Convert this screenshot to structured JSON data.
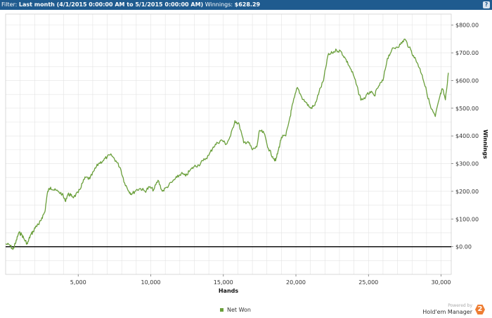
{
  "filter": {
    "label": "Filter:",
    "value": "Last month (4/1/2015 0:00:00 AM to 5/1/2015 0:00:00 AM)",
    "winnings_label": "Winnings:",
    "winnings_value": "$628.29",
    "help": "?"
  },
  "legend": {
    "label": "Net Won"
  },
  "branding": {
    "powered_by": "Powered by",
    "product": "Hold'em Manager",
    "logo_number": "2"
  },
  "colors": {
    "header": "#1f5b8f",
    "series": "#6a9f3b",
    "zero_line": "#000000",
    "grid": "#e3e3e3"
  },
  "chart_data": {
    "type": "line",
    "xlabel": "Hands",
    "ylabel": "Winnings",
    "xlim": [
      0,
      30700
    ],
    "ylim": [
      -100,
      840
    ],
    "x_ticks": [
      5000,
      10000,
      15000,
      20000,
      25000,
      30000
    ],
    "x_tick_labels": [
      "5,000",
      "10,000",
      "15,000",
      "20,000",
      "25,000",
      "30,000"
    ],
    "y_ticks": [
      0,
      100,
      200,
      300,
      400,
      500,
      600,
      700,
      800
    ],
    "y_tick_labels": [
      "$0.00",
      "$100.00",
      "$200.00",
      "$300.00",
      "$400.00",
      "$500.00",
      "$600.00",
      "$700.00",
      "$800.00"
    ],
    "y_axis_side": "right",
    "grid": true,
    "legend_position": "bottom-center",
    "series": [
      {
        "name": "Net Won",
        "x": [
          0,
          300,
          500,
          700,
          900,
          1100,
          1300,
          1500,
          1700,
          1900,
          2100,
          2300,
          2500,
          2700,
          2900,
          3100,
          3300,
          3600,
          3900,
          4100,
          4300,
          4500,
          4700,
          5000,
          5300,
          5500,
          5800,
          6100,
          6400,
          6700,
          7000,
          7300,
          7600,
          7900,
          8200,
          8500,
          8700,
          9000,
          9300,
          9600,
          9900,
          10200,
          10500,
          10800,
          11100,
          11500,
          11800,
          12100,
          12400,
          12700,
          13000,
          13300,
          13600,
          14000,
          14300,
          14600,
          14900,
          15200,
          15500,
          15800,
          16100,
          16400,
          16700,
          17000,
          17300,
          17500,
          17800,
          18100,
          18400,
          18600,
          18800,
          19000,
          19300,
          19600,
          19800,
          20100,
          20400,
          20700,
          21000,
          21300,
          21600,
          21900,
          22200,
          22500,
          22800,
          23100,
          23400,
          23700,
          24000,
          24300,
          24500,
          24800,
          25100,
          25400,
          25700,
          26000,
          26300,
          26600,
          26900,
          27200,
          27500,
          27800,
          28100,
          28400,
          28700,
          29000,
          29300,
          29600,
          29900,
          30100,
          30300,
          30500
        ],
        "values": [
          10,
          5,
          -10,
          15,
          50,
          45,
          25,
          10,
          40,
          55,
          75,
          80,
          105,
          125,
          200,
          215,
          205,
          200,
          190,
          165,
          190,
          185,
          180,
          195,
          230,
          250,
          245,
          275,
          300,
          310,
          325,
          330,
          310,
          285,
          230,
          200,
          190,
          205,
          210,
          200,
          215,
          205,
          240,
          200,
          215,
          235,
          250,
          265,
          255,
          275,
          290,
          295,
          310,
          330,
          360,
          375,
          385,
          370,
          400,
          455,
          440,
          375,
          380,
          350,
          360,
          420,
          410,
          355,
          325,
          310,
          350,
          395,
          400,
          470,
          520,
          575,
          540,
          520,
          500,
          510,
          560,
          600,
          690,
          700,
          710,
          705,
          680,
          650,
          615,
          560,
          530,
          540,
          560,
          545,
          580,
          600,
          680,
          710,
          720,
          730,
          750,
          720,
          690,
          660,
          620,
          560,
          500,
          470,
          540,
          570,
          530,
          628
        ]
      }
    ]
  }
}
